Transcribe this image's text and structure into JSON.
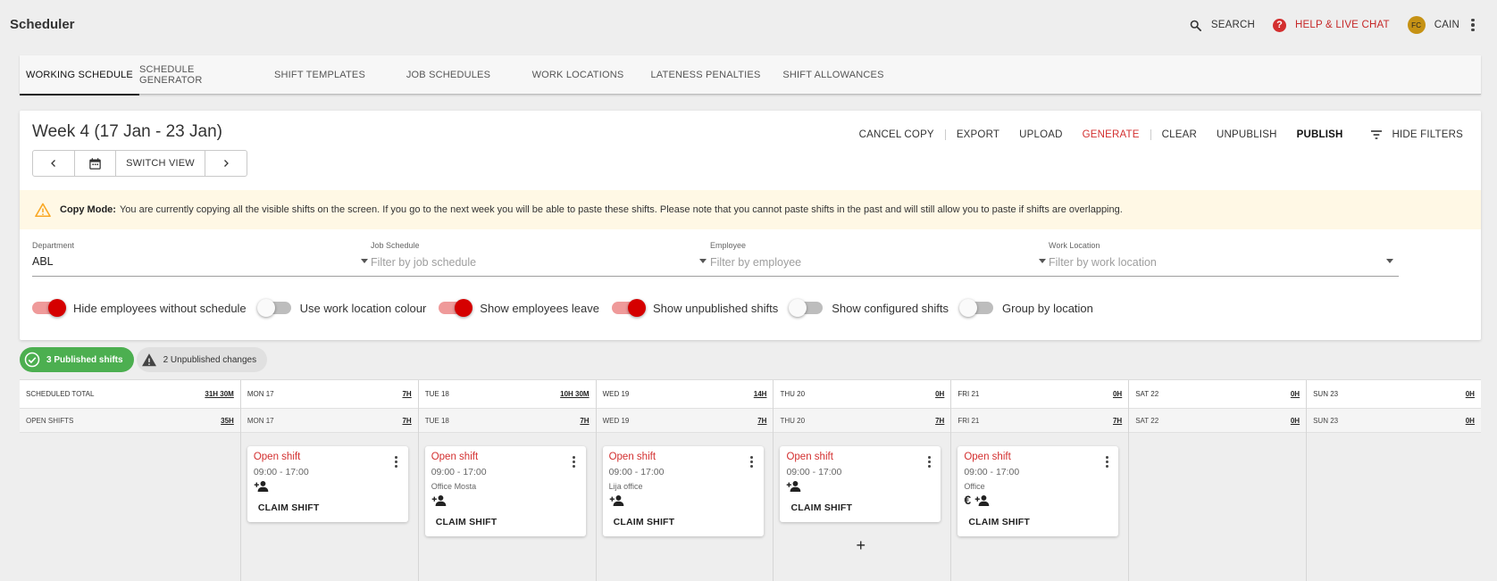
{
  "app": {
    "title": "Scheduler",
    "search_label": "SEARCH",
    "help_label": "HELP & LIVE CHAT",
    "user_initials": "FC",
    "user_name": "CAIN"
  },
  "tabs": [
    {
      "label": "WORKING SCHEDULE",
      "active": true
    },
    {
      "label": "SCHEDULE GENERATOR"
    },
    {
      "label": "SHIFT TEMPLATES"
    },
    {
      "label": "JOB SCHEDULES"
    },
    {
      "label": "WORK LOCATIONS"
    },
    {
      "label": "LATENESS PENALTIES"
    },
    {
      "label": "SHIFT ALLOWANCES"
    }
  ],
  "week": {
    "title": "Week 4 (17 Jan - 23 Jan)",
    "switch_view_label": "SWITCH VIEW"
  },
  "actions": {
    "cancel_copy": "CANCEL COPY",
    "export": "EXPORT",
    "upload": "UPLOAD",
    "generate": "GENERATE",
    "clear": "CLEAR",
    "unpublish": "UNPUBLISH",
    "publish": "PUBLISH",
    "hide_filters": "HIDE FILTERS"
  },
  "banner": {
    "bold": "Copy Mode:",
    "text": "You are currently copying all the visible shifts on the screen. If you go to the next week you will be able to paste these shifts. Please note that you cannot paste shifts in the past and will still allow you to paste if shifts are overlapping."
  },
  "filters": [
    {
      "label": "Department",
      "value": "ABL",
      "placeholder": ""
    },
    {
      "label": "Job Schedule",
      "value": "",
      "placeholder": "Filter by job schedule"
    },
    {
      "label": "Employee",
      "value": "",
      "placeholder": "Filter by employee"
    },
    {
      "label": "Work Location",
      "value": "",
      "placeholder": "Filter by work location"
    }
  ],
  "toggles": [
    {
      "label": "Hide employees without schedule",
      "on": true
    },
    {
      "label": "Use work location colour",
      "on": false
    },
    {
      "label": "Show employees leave",
      "on": true
    },
    {
      "label": "Show unpublished shifts",
      "on": true
    },
    {
      "label": "Show configured shifts",
      "on": false
    },
    {
      "label": "Group by location",
      "on": false
    }
  ],
  "status": {
    "published": "3 Published shifts",
    "unpublished": "2 Unpublished changes"
  },
  "colors": {
    "accent_red": "#d32f2f",
    "published_green": "#4caf50",
    "banner_bg": "#fff8e5"
  },
  "grid": {
    "columns": [
      {
        "head": "SCHEDULED TOTAL",
        "head_hrs": "31H 30M",
        "open": "OPEN SHIFTS",
        "open_hrs": "35H"
      },
      {
        "head": "MON 17",
        "head_hrs": "7H",
        "open": "MON 17",
        "open_hrs": "7H"
      },
      {
        "head": "TUE 18",
        "head_hrs": "10H 30M",
        "open": "TUE 18",
        "open_hrs": "7H"
      },
      {
        "head": "WED 19",
        "head_hrs": "14H",
        "open": "WED 19",
        "open_hrs": "7H"
      },
      {
        "head": "THU 20",
        "head_hrs": "0H",
        "open": "THU 20",
        "open_hrs": "7H"
      },
      {
        "head": "FRI 21",
        "head_hrs": "0H",
        "open": "FRI 21",
        "open_hrs": "7H"
      },
      {
        "head": "SAT 22",
        "head_hrs": "0H",
        "open": "SAT 22",
        "open_hrs": "0H"
      },
      {
        "head": "SUN 23",
        "head_hrs": "0H",
        "open": "SUN 23",
        "open_hrs": "0H"
      }
    ],
    "cards": [
      {
        "title": "Open shift",
        "time": "09:00 - 17:00",
        "location": "",
        "claim": "CLAIM SHIFT"
      },
      {
        "title": "Open shift",
        "time": "09:00 - 17:00",
        "location": "Office Mosta",
        "claim": "CLAIM SHIFT"
      },
      {
        "title": "Open shift",
        "time": "09:00 - 17:00",
        "location": "Lija office",
        "claim": "CLAIM SHIFT"
      },
      {
        "title": "Open shift",
        "time": "09:00 - 17:00",
        "location": "",
        "claim": "CLAIM SHIFT"
      },
      {
        "title": "Open shift",
        "time": "09:00 - 17:00",
        "location": "Office",
        "claim": "CLAIM SHIFT"
      }
    ],
    "add_label": "+"
  }
}
